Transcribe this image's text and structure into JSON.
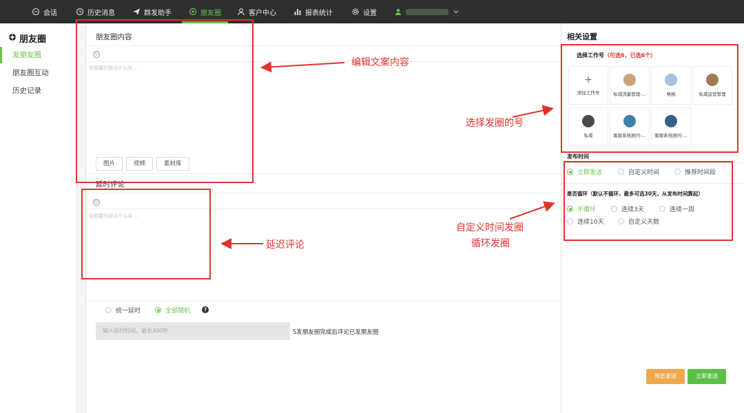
{
  "nav": {
    "items": [
      {
        "label": "会话",
        "icon": "chat-icon"
      },
      {
        "label": "历史消息",
        "icon": "clock-icon"
      },
      {
        "label": "群发助手",
        "icon": "send-icon"
      },
      {
        "label": "朋友圈",
        "icon": "moments-icon",
        "active": true
      },
      {
        "label": "客户中心",
        "icon": "user-icon"
      },
      {
        "label": "报表统计",
        "icon": "bar-chart-icon"
      },
      {
        "label": "设置",
        "icon": "gear-icon"
      }
    ],
    "user_icon": "user-avatar-icon",
    "dropdown_icon": "chevron-down-icon"
  },
  "sidebar": {
    "title": "朋友圈",
    "items": [
      {
        "label": "发朋友圈",
        "active": true
      },
      {
        "label": "朋友圈互动"
      },
      {
        "label": "历史记录"
      }
    ]
  },
  "post": {
    "title": "朋友圈内容",
    "placeholder": "你想要的聊点什么呢 ...",
    "media_buttons": [
      "图片",
      "视频",
      "素材库"
    ]
  },
  "comment": {
    "title": "延时评论",
    "placeholder": "你想要的聊点什么呢 ..."
  },
  "delay": {
    "options": [
      {
        "label": "统一延时",
        "checked": false
      },
      {
        "label": "全部随机",
        "checked": true
      }
    ],
    "help": "?",
    "input_placeholder": "输入延时时间，最长300秒",
    "suffix": "S发朋友圈完成后评论已发朋友圈"
  },
  "right": {
    "title": "相关设置",
    "account_label": "选择工作号",
    "account_hint": "（可选6，已选6个）",
    "accounts": [
      {
        "label": "添加工作号",
        "add": true
      },
      {
        "label": "私域流量管理-...",
        "color": "#c8a27a"
      },
      {
        "label": "格格",
        "color": "#9fc3e4"
      },
      {
        "label": "私域运营管理",
        "color": "#a07b52"
      },
      {
        "label": "私域",
        "color": "#4a4a4a"
      },
      {
        "label": "客服系统顾问-...",
        "color": "#3f7fa8"
      },
      {
        "label": "客服系统顾问-...",
        "color": "#3a5f86"
      }
    ],
    "publish_time_label": "发布时间",
    "publish_options": [
      {
        "label": "立即发送",
        "checked": true
      },
      {
        "label": "自定义时间",
        "checked": false
      },
      {
        "label": "推荐时间段",
        "checked": false
      }
    ],
    "loop_label": "是否循环（默认不循环，最多可选30天，从发布时间算起）",
    "loop_options": [
      {
        "label": "不循环",
        "checked": true
      },
      {
        "label": "连续3天",
        "checked": false
      },
      {
        "label": "连续一周",
        "checked": false
      },
      {
        "label": "连续10天",
        "checked": false
      },
      {
        "label": "自定义天数",
        "checked": false
      }
    ],
    "preview_button": "预览发送",
    "send_button": "立即发送"
  },
  "annotations": [
    "编辑文案内容",
    "选择发圈的号",
    "延迟评论",
    "自定义时间发圈",
    "循环发圈"
  ],
  "colors": {
    "accent": "#6cc24a",
    "annotation": "#e0322b",
    "nav_bg": "#2f2f2f",
    "preview_button": "#f0a94a",
    "send_button": "#5cc048"
  }
}
